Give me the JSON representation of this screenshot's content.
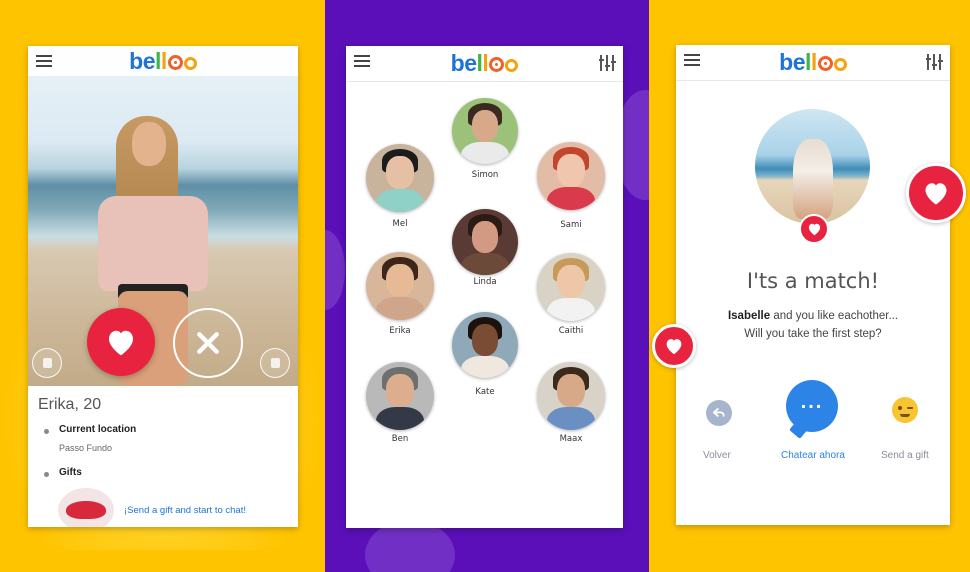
{
  "brand": {
    "logo_text": "belloo"
  },
  "screen_left": {
    "profile_name": "Erika, 20",
    "location_label": "Current location",
    "location_value": "Passo Fundo",
    "gifts_label": "Gifts",
    "gift_cta": "¡Send a gift and start to chat!"
  },
  "screen_middle": {
    "people": [
      {
        "name": "Simon"
      },
      {
        "name": "Mel"
      },
      {
        "name": "Sami"
      },
      {
        "name": "Linda"
      },
      {
        "name": "Erika"
      },
      {
        "name": "Caithi"
      },
      {
        "name": "Kate"
      },
      {
        "name": "Ben"
      },
      {
        "name": "Maax"
      }
    ]
  },
  "screen_right": {
    "title": "I'ts a match!",
    "match_name": "Isabelle",
    "line1_rest": "and you like eachother...",
    "line2": "Will you take the first step?",
    "back_label": "Volver",
    "chat_label": "Chatear ahora",
    "gift_label": "Send a gift"
  },
  "colors": {
    "accent_red": "#e8233f",
    "chat_blue": "#2b84e6",
    "bg_yellow": "#ffc400",
    "bg_purple": "#5a0fb8"
  },
  "icons": [
    "menu-icon",
    "filter-icon",
    "heart-icon",
    "close-icon",
    "back-arrow-icon",
    "chat-bubble-icon",
    "wink-emoji-icon"
  ]
}
